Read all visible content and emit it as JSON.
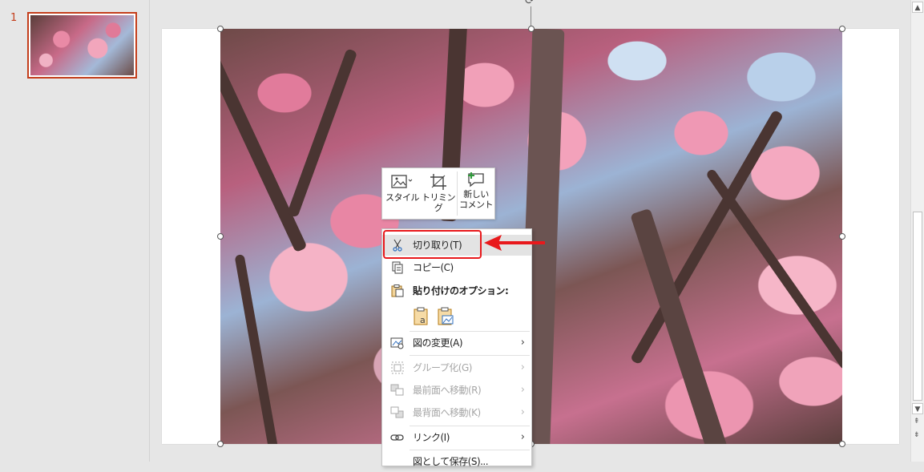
{
  "slide_panel": {
    "slide_number": "1"
  },
  "mini_toolbar": {
    "style_label": "スタイル",
    "crop_label": "トリミング",
    "new_comment_label_line1": "新しい",
    "new_comment_label_line2": "コメント"
  },
  "context_menu": {
    "cut": "切り取り(T)",
    "copy": "コピー(C)",
    "paste_options_title": "貼り付けのオプション:",
    "change_picture": "図の変更(A)",
    "group": "グループ化(G)",
    "bring_to_front": "最前面へ移動(R)",
    "send_to_back": "最背面へ移動(K)",
    "link": "リンク(I)",
    "save_as_picture": "図として保存(S)..."
  },
  "colors": {
    "selection_accent": "#c43e1c",
    "highlight": "#e8191c"
  },
  "icons": [
    "rotate-icon",
    "style-icon",
    "crop-icon",
    "new-comment-icon",
    "scissors-icon",
    "copy-icon",
    "paste-icon",
    "paste-keep-text-icon",
    "paste-picture-icon",
    "change-picture-icon",
    "group-icon",
    "bring-front-icon",
    "send-back-icon",
    "link-icon",
    "chevron-right-icon",
    "scroll-up-icon",
    "scroll-down-icon"
  ]
}
